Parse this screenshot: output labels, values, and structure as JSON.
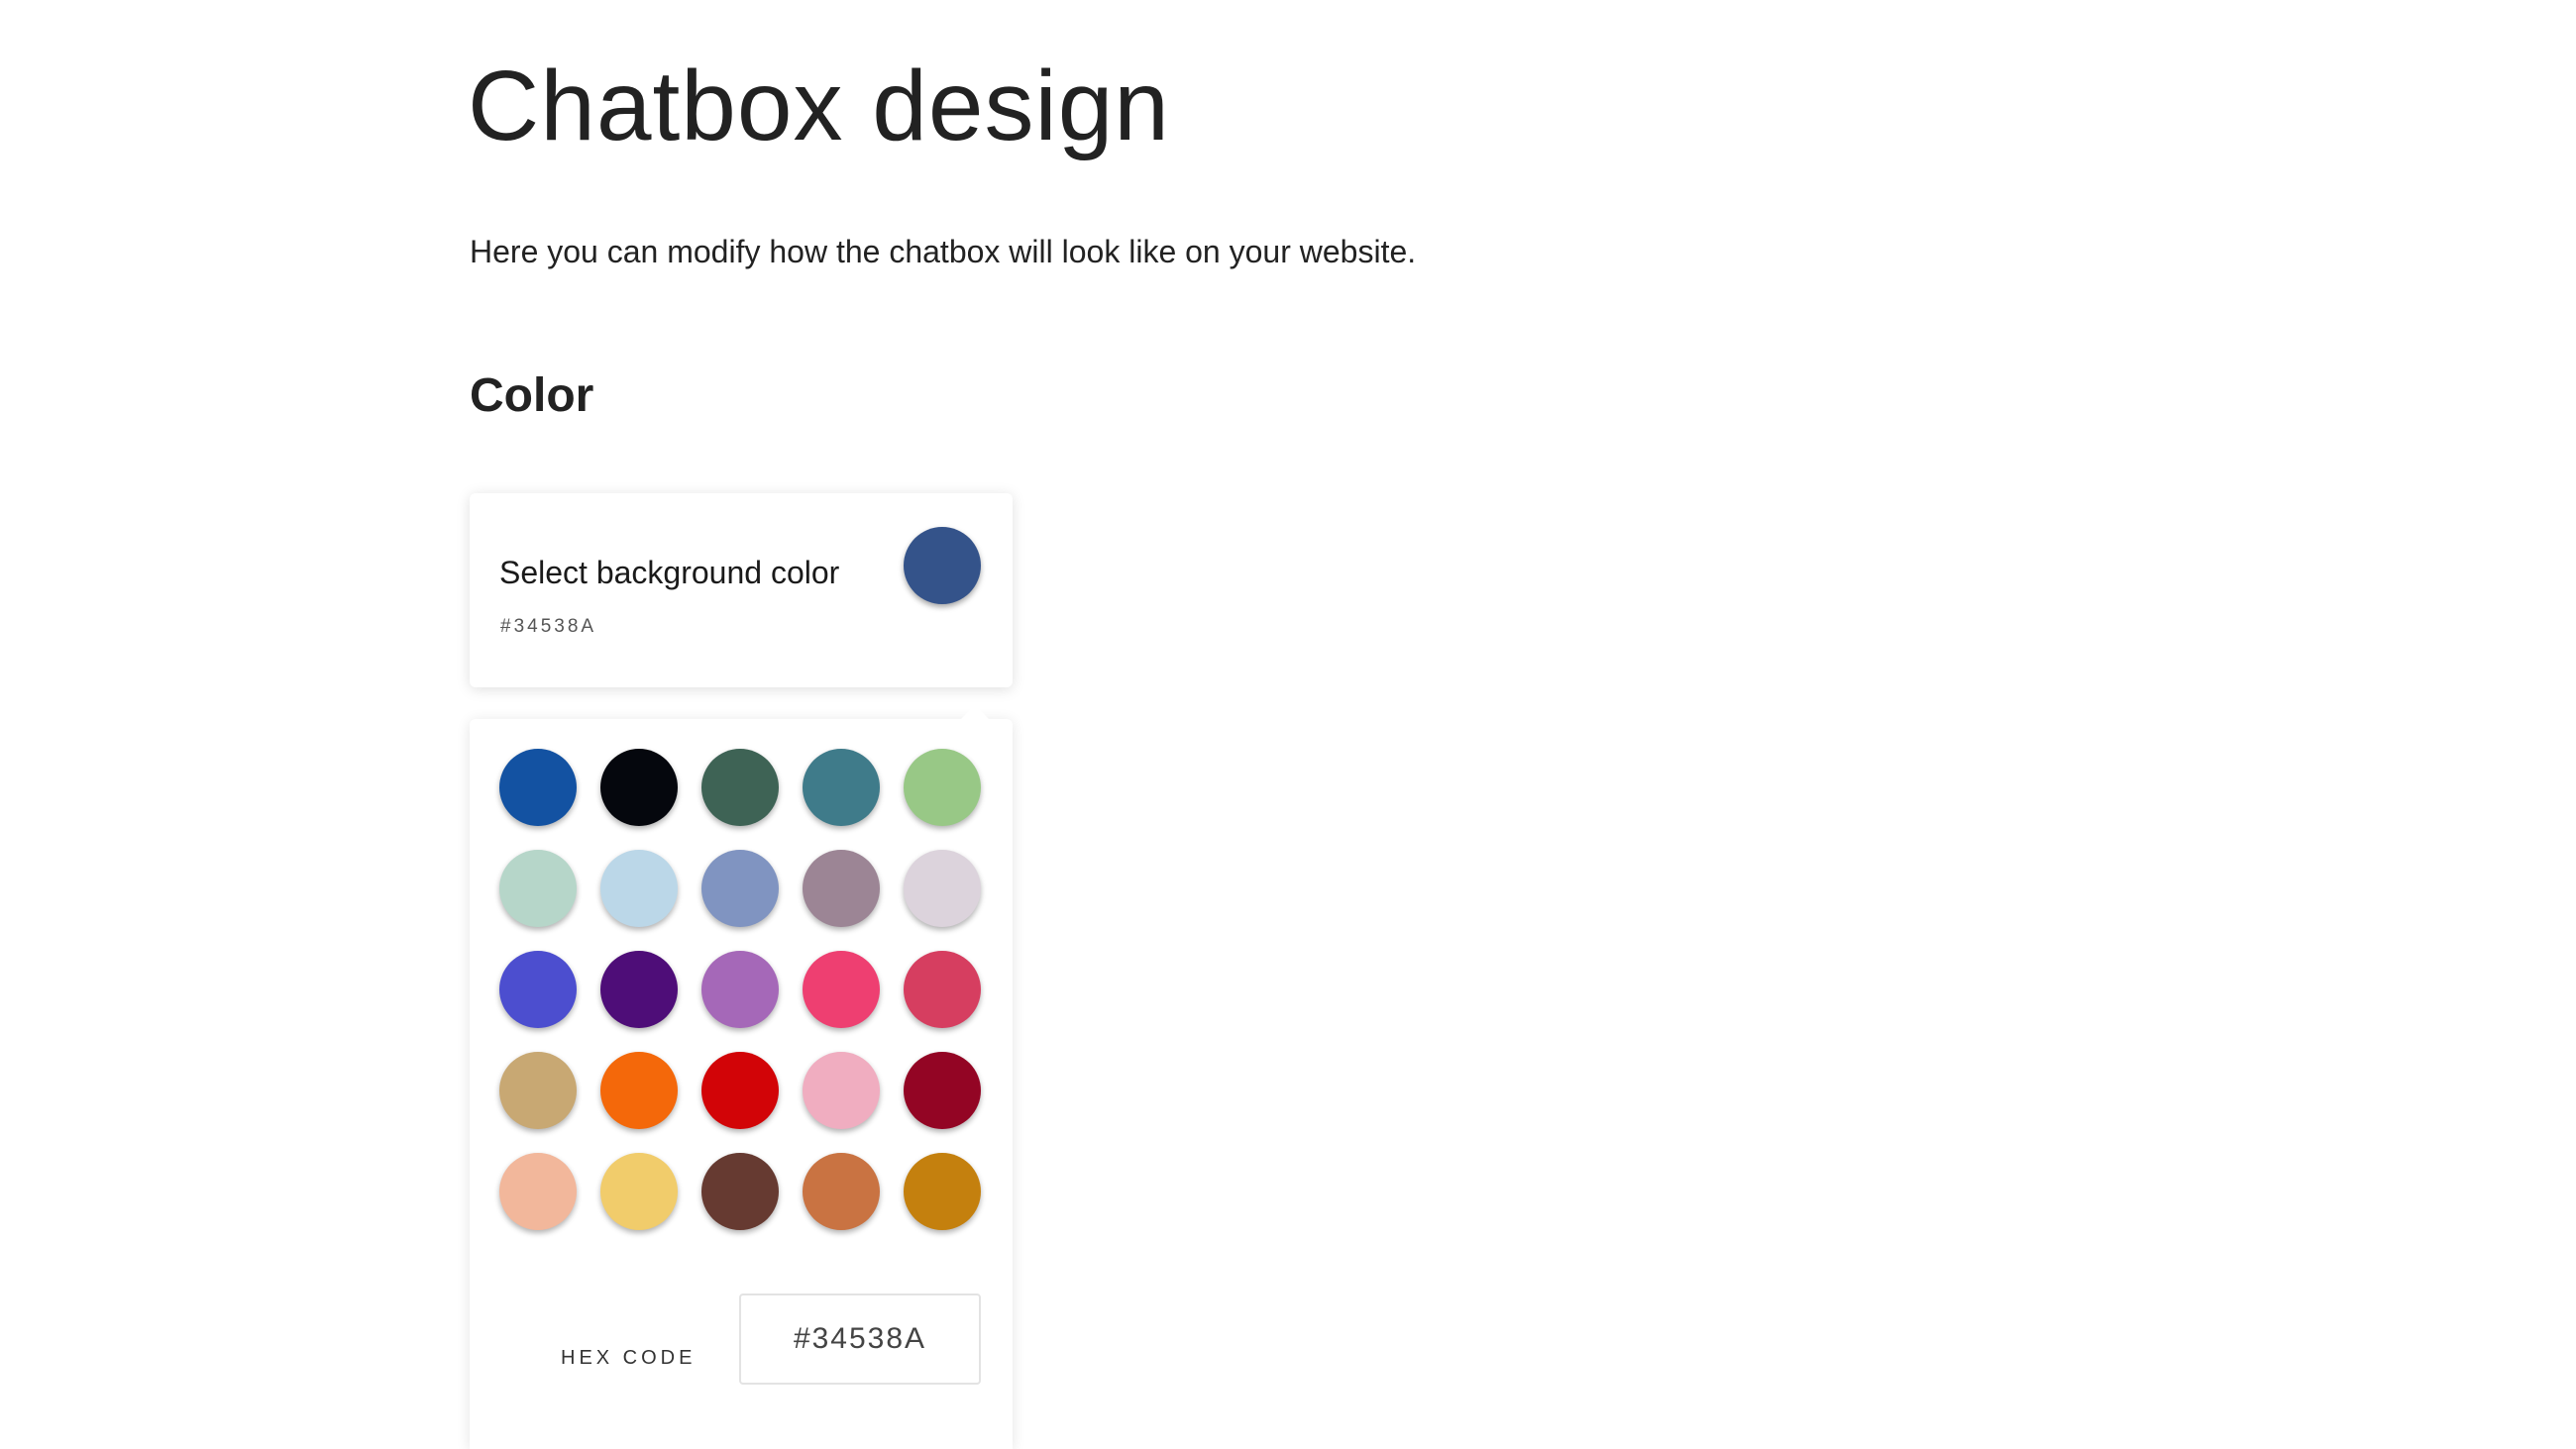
{
  "page": {
    "title": "Chatbox design",
    "subtitle": "Here you can modify how the chatbox will look like on your website."
  },
  "color_section": {
    "heading": "Color",
    "card": {
      "label": "Select background color",
      "hex": "#34538A",
      "preview_color": "#34538A"
    },
    "palette": [
      "#1352A2",
      "#05070D",
      "#3E6355",
      "#3F7B8A",
      "#98C886",
      "#B6D6C9",
      "#BBD7E8",
      "#8094C1",
      "#9C8595",
      "#DCD3DC",
      "#4C4ECF",
      "#4E0D78",
      "#A568B8",
      "#EE3F71",
      "#D63E60",
      "#C8A873",
      "#F4680A",
      "#D20407",
      "#F0ADC0",
      "#930524",
      "#F2B79B",
      "#F1CC6B",
      "#663A31",
      "#C97342",
      "#C4800E"
    ],
    "hex_code_label": "HEX CODE",
    "hex_input_value": "#34538A"
  }
}
